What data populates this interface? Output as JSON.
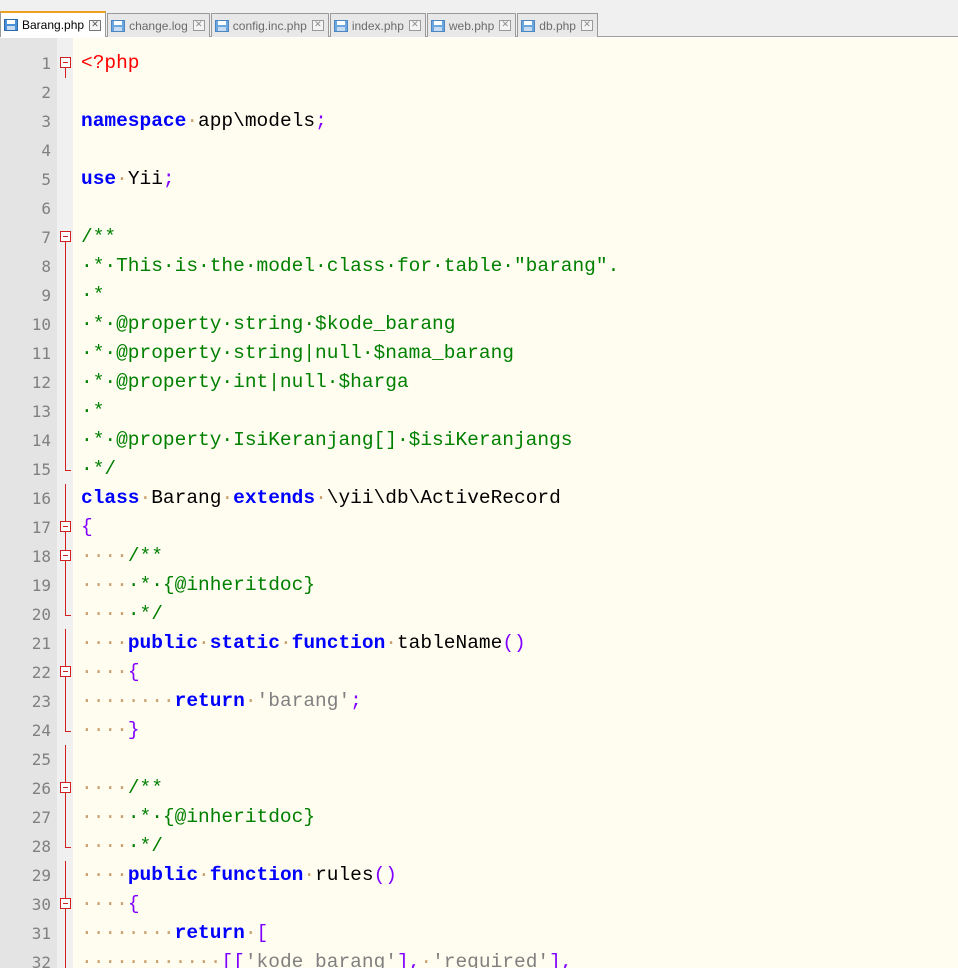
{
  "tabs": [
    {
      "name": "Barang.php",
      "active": true
    },
    {
      "name": "change.log",
      "active": false
    },
    {
      "name": "config.inc.php",
      "active": false
    },
    {
      "name": "index.php",
      "active": false
    },
    {
      "name": "web.php",
      "active": false
    },
    {
      "name": "db.php",
      "active": false
    }
  ],
  "icons": {
    "file": "save-file-icon",
    "close": "close-tab-icon",
    "fold": "fold-toggle-icon"
  },
  "colors": {
    "keyword": "#0000ff",
    "comment": "#008000",
    "string": "#808080",
    "php_tag": "#ff0000",
    "operator": "#8000ff",
    "fold_marker": "#d02020",
    "background": "#fffcf0"
  },
  "lines": [
    {
      "n": "1",
      "fold": "open",
      "tokens": [
        [
          "php",
          "<?php"
        ]
      ]
    },
    {
      "n": "2",
      "fold": "",
      "tokens": []
    },
    {
      "n": "3",
      "fold": "",
      "tokens": [
        [
          "kw",
          "namespace"
        ],
        [
          "ws",
          "·"
        ],
        [
          "t",
          "app\\models"
        ],
        [
          "pu",
          ";"
        ]
      ]
    },
    {
      "n": "4",
      "fold": "",
      "tokens": []
    },
    {
      "n": "5",
      "fold": "",
      "tokens": [
        [
          "kw",
          "use"
        ],
        [
          "ws",
          "·"
        ],
        [
          "t",
          "Yii"
        ],
        [
          "pu",
          ";"
        ]
      ]
    },
    {
      "n": "6",
      "fold": "",
      "tokens": []
    },
    {
      "n": "7",
      "fold": "open",
      "tokens": [
        [
          "cm",
          "/**"
        ]
      ]
    },
    {
      "n": "8",
      "fold": "line",
      "tokens": [
        [
          "cm",
          "·*·This·is·the·model·class·for·table·\"barang\"."
        ]
      ]
    },
    {
      "n": "9",
      "fold": "line",
      "tokens": [
        [
          "cm",
          "·*"
        ]
      ]
    },
    {
      "n": "10",
      "fold": "line",
      "tokens": [
        [
          "cm",
          "·*·@property·string·$kode_barang"
        ]
      ]
    },
    {
      "n": "11",
      "fold": "line",
      "tokens": [
        [
          "cm",
          "·*·@property·string|null·$nama_barang"
        ]
      ]
    },
    {
      "n": "12",
      "fold": "line",
      "tokens": [
        [
          "cm",
          "·*·@property·int|null·$harga"
        ]
      ]
    },
    {
      "n": "13",
      "fold": "line",
      "tokens": [
        [
          "cm",
          "·*"
        ]
      ]
    },
    {
      "n": "14",
      "fold": "line",
      "tokens": [
        [
          "cm",
          "·*·@property·IsiKeranjang[]·$isiKeranjangs"
        ]
      ]
    },
    {
      "n": "15",
      "fold": "end",
      "tokens": [
        [
          "cm",
          "·*/"
        ]
      ]
    },
    {
      "n": "16",
      "fold": "line",
      "tokens": [
        [
          "kw",
          "class"
        ],
        [
          "ws",
          "·"
        ],
        [
          "t",
          "Barang"
        ],
        [
          "ws",
          "·"
        ],
        [
          "kw",
          "extends"
        ],
        [
          "ws",
          "·"
        ],
        [
          "t",
          "\\yii\\db\\ActiveRecord"
        ]
      ]
    },
    {
      "n": "17",
      "fold": "open",
      "tokens": [
        [
          "pu",
          "{"
        ]
      ]
    },
    {
      "n": "18",
      "fold": "open",
      "tokens": [
        [
          "ws",
          "····"
        ],
        [
          "cm",
          "/**"
        ]
      ]
    },
    {
      "n": "19",
      "fold": "line",
      "tokens": [
        [
          "ws",
          "····"
        ],
        [
          "cm",
          "·*·{@inheritdoc}"
        ]
      ]
    },
    {
      "n": "20",
      "fold": "end",
      "tokens": [
        [
          "ws",
          "····"
        ],
        [
          "cm",
          "·*/"
        ]
      ]
    },
    {
      "n": "21",
      "fold": "line",
      "tokens": [
        [
          "ws",
          "····"
        ],
        [
          "kw",
          "public"
        ],
        [
          "ws",
          "·"
        ],
        [
          "kw",
          "static"
        ],
        [
          "ws",
          "·"
        ],
        [
          "kw",
          "function"
        ],
        [
          "ws",
          "·"
        ],
        [
          "t",
          "tableName"
        ],
        [
          "pu",
          "()"
        ]
      ]
    },
    {
      "n": "22",
      "fold": "open",
      "tokens": [
        [
          "ws",
          "····"
        ],
        [
          "pu",
          "{"
        ]
      ]
    },
    {
      "n": "23",
      "fold": "line",
      "tokens": [
        [
          "ws",
          "········"
        ],
        [
          "kw",
          "return"
        ],
        [
          "ws",
          "·"
        ],
        [
          "str",
          "'barang'"
        ],
        [
          "pu",
          ";"
        ]
      ]
    },
    {
      "n": "24",
      "fold": "end",
      "tokens": [
        [
          "ws",
          "····"
        ],
        [
          "pu",
          "}"
        ]
      ]
    },
    {
      "n": "25",
      "fold": "line",
      "tokens": []
    },
    {
      "n": "26",
      "fold": "open",
      "tokens": [
        [
          "ws",
          "····"
        ],
        [
          "cm",
          "/**"
        ]
      ]
    },
    {
      "n": "27",
      "fold": "line",
      "tokens": [
        [
          "ws",
          "····"
        ],
        [
          "cm",
          "·*·{@inheritdoc}"
        ]
      ]
    },
    {
      "n": "28",
      "fold": "end",
      "tokens": [
        [
          "ws",
          "····"
        ],
        [
          "cm",
          "·*/"
        ]
      ]
    },
    {
      "n": "29",
      "fold": "line",
      "tokens": [
        [
          "ws",
          "····"
        ],
        [
          "kw",
          "public"
        ],
        [
          "ws",
          "·"
        ],
        [
          "kw",
          "function"
        ],
        [
          "ws",
          "·"
        ],
        [
          "t",
          "rules"
        ],
        [
          "pu",
          "()"
        ]
      ]
    },
    {
      "n": "30",
      "fold": "open",
      "tokens": [
        [
          "ws",
          "····"
        ],
        [
          "pu",
          "{"
        ]
      ]
    },
    {
      "n": "31",
      "fold": "line",
      "tokens": [
        [
          "ws",
          "········"
        ],
        [
          "kw",
          "return"
        ],
        [
          "ws",
          "·"
        ],
        [
          "pu",
          "["
        ]
      ]
    },
    {
      "n": "32",
      "fold": "line",
      "tokens": [
        [
          "ws",
          "············"
        ],
        [
          "pu",
          "[["
        ],
        [
          "str",
          "'kode_barang'"
        ],
        [
          "pu",
          "],"
        ],
        [
          "ws",
          "·"
        ],
        [
          "str",
          "'required'"
        ],
        [
          "pu",
          "],"
        ]
      ]
    }
  ]
}
